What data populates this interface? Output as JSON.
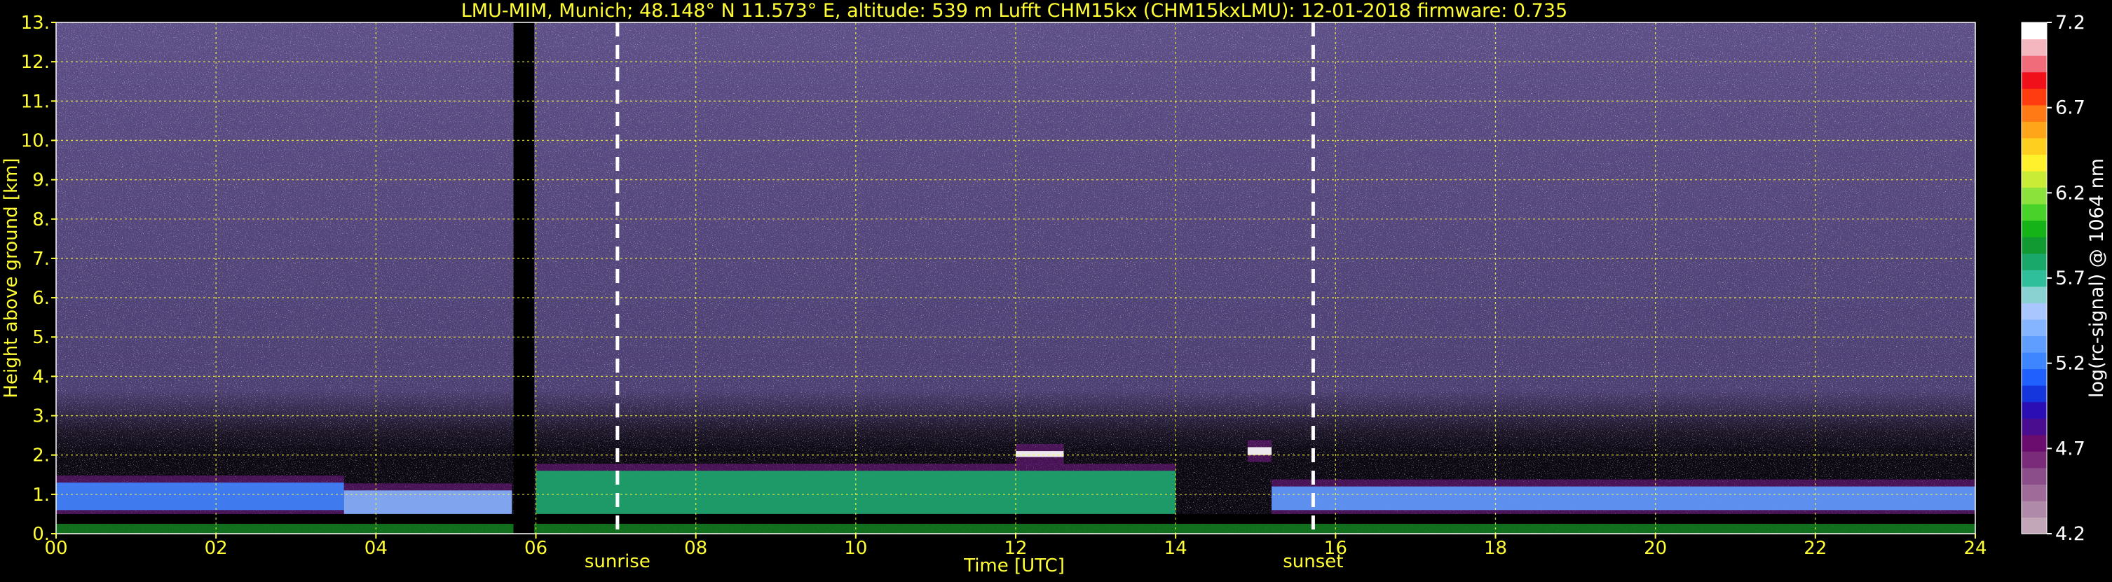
{
  "chart_data": {
    "type": "heatmap",
    "title": "LMU-MIM, Munich; 48.148° N 11.573° E, altitude: 539 m     Lufft CHM15kx (CHM15kxLMU): 12-01-2018     firmware: 0.735",
    "xlabel": "Time [UTC]",
    "ylabel": "Height above ground [km]",
    "xlim": [
      0,
      24
    ],
    "ylim": [
      0,
      13
    ],
    "x_ticks": [
      "00",
      "02",
      "04",
      "06",
      "08",
      "10",
      "12",
      "14",
      "16",
      "18",
      "20",
      "22",
      "24"
    ],
    "y_ticks": [
      "0.",
      "1.",
      "2.",
      "3.",
      "4.",
      "5.",
      "6.",
      "7.",
      "8.",
      "9.",
      "10.",
      "11.",
      "12.",
      "13."
    ],
    "grid": true,
    "colorbar": {
      "label": "log(rc-signal) @ 1064 nm",
      "range": [
        4.2,
        7.2
      ],
      "ticks": [
        "4.2",
        "4.7",
        "5.2",
        "5.7",
        "6.2",
        "6.7",
        "7.2"
      ],
      "colors": [
        "#c2a7b8",
        "#b08aa9",
        "#9f6c99",
        "#8c4e8a",
        "#7a2c7a",
        "#6a0d6e",
        "#4b0d90",
        "#2b0fb4",
        "#1436dc",
        "#2060ff",
        "#3e86ff",
        "#5f9eff",
        "#86b5ff",
        "#a9c6ff",
        "#8ad1d1",
        "#2fbf9a",
        "#1aa86a",
        "#119a32",
        "#16b318",
        "#48d22a",
        "#8ae23a",
        "#c9ed36",
        "#fff12c",
        "#ffcf1f",
        "#ffa51a",
        "#ff7a14",
        "#ff3c10",
        "#f0101a",
        "#f06c7a",
        "#f4b7bf",
        "#ffffff"
      ]
    },
    "annotations": [
      {
        "text": "sunrise",
        "x": 7.02
      },
      {
        "text": "sunset",
        "x": 15.72
      }
    ],
    "data_gap": [
      5.72,
      5.98
    ],
    "signal_layers": [
      {
        "name": "residual layer",
        "x": [
          0,
          3.6
        ],
        "y": [
          0.6,
          1.3
        ],
        "level": 5.2
      },
      {
        "name": "aerosol layer",
        "x": [
          3.6,
          5.7
        ],
        "y": [
          0.5,
          1.1
        ],
        "level": 5.4
      },
      {
        "name": "aerosol layer",
        "x": [
          6.0,
          14.0
        ],
        "y": [
          0.5,
          1.6
        ],
        "level": 5.8
      },
      {
        "name": "aerosol layer",
        "x": [
          15.2,
          24
        ],
        "y": [
          0.6,
          1.2
        ],
        "level": 5.3
      },
      {
        "name": "cloud",
        "x": [
          12.0,
          12.6
        ],
        "y": [
          1.95,
          2.1
        ],
        "level": 7.2
      },
      {
        "name": "cloud",
        "x": [
          14.9,
          15.2
        ],
        "y": [
          2.0,
          2.2
        ],
        "level": 7.2
      }
    ]
  }
}
